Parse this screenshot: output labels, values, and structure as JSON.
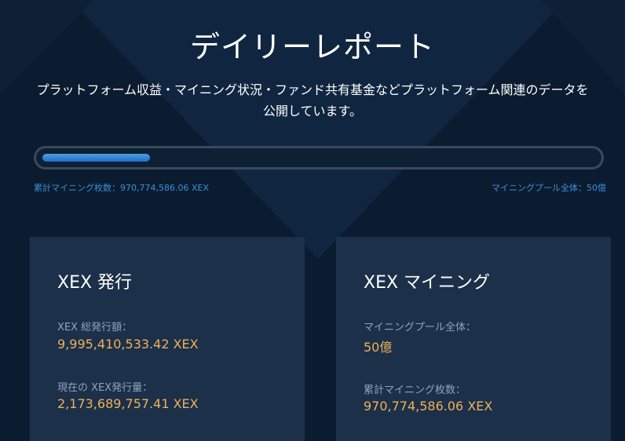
{
  "header": {
    "title": "デイリーレポート",
    "subtitle": "プラットフォーム収益・マイニング状況・ファンド共有基金などプラットフォーム関連のデータを公開しています。"
  },
  "progress": {
    "fraction": 0.194,
    "left_text": "累計マイニング枚数：970,774,586.06 XEX",
    "right_text": "マイニングプール全体：50億"
  },
  "cards": [
    {
      "title": "XEX 発行",
      "stats": [
        {
          "label": "XEX 総発行額：",
          "value": "9,995,410,533.42 XEX"
        },
        {
          "label": "現在の XEX発行量：",
          "value": "2,173,689,757.41 XEX"
        }
      ]
    },
    {
      "title": "XEX マイニング",
      "stats": [
        {
          "label": "マイニングプール全体：",
          "value": "50億"
        },
        {
          "label": "累計マイニング枚数：",
          "value": "970,774,586.06 XEX"
        }
      ]
    }
  ],
  "colors": {
    "background": "#0b1c30",
    "card": "#1c3049",
    "accent_value": "#f0b15a",
    "progress_fill": "#2f86d6",
    "label": "#8fa3bd"
  }
}
